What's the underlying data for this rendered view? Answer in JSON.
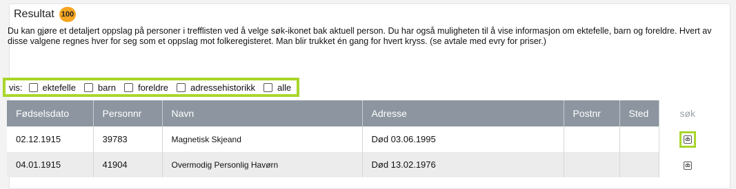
{
  "header": {
    "title": "Resultat",
    "count": "100"
  },
  "description": "Du kan gjøre et detaljert oppslag på personer i trefflisten ved å velge søk-ikonet bak aktuell person. Du har også muligheten til å vise informasjon om ektefelle, barn og foreldre. Hvert av disse valgene regnes hver for seg som et oppslag mot folkeregisteret. Man blir trukket én gang for hvert kryss. (se avtale med evry for priser.)",
  "filters": {
    "label": "vis:",
    "options": [
      {
        "label": "ektefelle",
        "checked": false
      },
      {
        "label": "barn",
        "checked": false
      },
      {
        "label": "foreldre",
        "checked": false
      },
      {
        "label": "adressehistorikk",
        "checked": false
      },
      {
        "label": "alle",
        "checked": false
      }
    ]
  },
  "table": {
    "columns": [
      "Fødselsdato",
      "Personnr",
      "Navn",
      "Adresse",
      "Postnr",
      "Sted",
      "søk"
    ],
    "rows": [
      {
        "fodselsdato": "02.12.1915",
        "personnr": "39783",
        "navn": "Magnetisk Skjeand",
        "adresse": "Død 03.06.1995",
        "postnr": "",
        "sted": ""
      },
      {
        "fodselsdato": "04.01.1915",
        "personnr": "41904",
        "navn": "Overmodig Personlig Havørn",
        "adresse": "Død 13.02.1976",
        "postnr": "",
        "sted": ""
      }
    ]
  },
  "colors": {
    "highlight": "#a9d62a",
    "badge": "#f5a623",
    "table_header": "#8d96a0"
  },
  "icons": {
    "search": "search-icon"
  }
}
